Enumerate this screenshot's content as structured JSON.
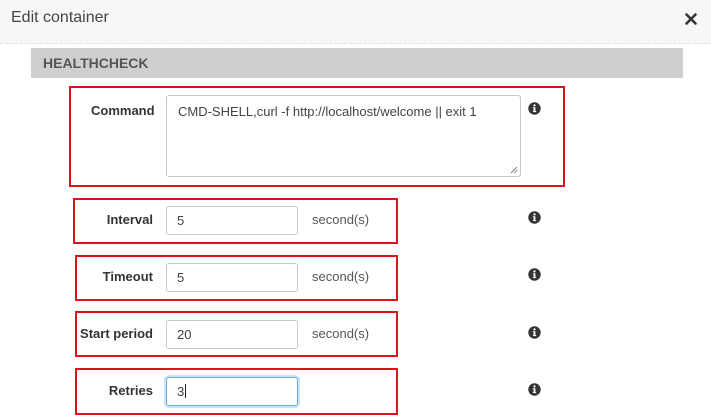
{
  "modal": {
    "title": "Edit container"
  },
  "section": {
    "title": "HEALTHCHECK"
  },
  "fields": {
    "command": {
      "label": "Command",
      "value": "CMD-SHELL,curl -f http://localhost/welcome || exit 1"
    },
    "interval": {
      "label": "Interval",
      "value": "5",
      "unit": "second(s)"
    },
    "timeout": {
      "label": "Timeout",
      "value": "5",
      "unit": "second(s)"
    },
    "start_period": {
      "label": "Start period",
      "value": "20",
      "unit": "second(s)"
    },
    "retries": {
      "label": "Retries",
      "value": "3"
    }
  },
  "icons": {
    "close": "close-icon",
    "info": "info-icon"
  },
  "colors": {
    "highlight_border": "#d9141c",
    "section_bar": "#cfcfcf",
    "focus_ring": "#66afe9"
  }
}
